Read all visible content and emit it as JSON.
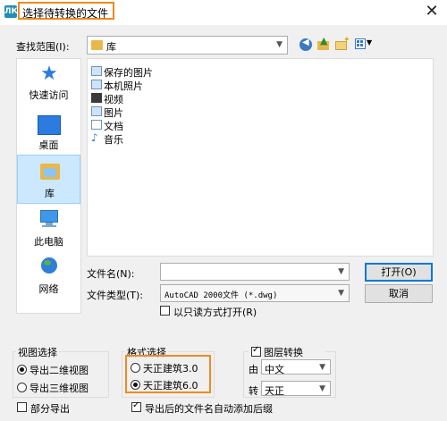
{
  "window": {
    "title": "选择待转换的文件",
    "app_icon_text": "ЛК"
  },
  "lookin": {
    "label": "查找范围(I):",
    "value": "库"
  },
  "places": [
    {
      "label": "快速访问"
    },
    {
      "label": "桌面"
    },
    {
      "label": "库"
    },
    {
      "label": "此电脑"
    },
    {
      "label": "网络"
    }
  ],
  "files": [
    {
      "name": "保存的图片"
    },
    {
      "name": "本机照片"
    },
    {
      "name": "视频"
    },
    {
      "name": "图片"
    },
    {
      "name": "文档"
    },
    {
      "name": "音乐"
    }
  ],
  "filename": {
    "label": "文件名(N):",
    "value": ""
  },
  "filetype": {
    "label": "文件类型(T):",
    "value": "AutoCAD 2000文件 (*.dwg)"
  },
  "readonly": {
    "label": "以只读方式打开(R)",
    "checked": false
  },
  "buttons": {
    "open": "打开(O)",
    "cancel": "取消"
  },
  "view_group": {
    "title": "视图选择",
    "options": [
      {
        "label": "导出二维视图",
        "selected": true
      },
      {
        "label": "导出三维视图",
        "selected": false
      }
    ]
  },
  "partial_export": {
    "label": "部分导出",
    "checked": false
  },
  "format_group": {
    "title": "格式选择",
    "options": [
      {
        "label": "天正建筑3.0",
        "selected": false
      },
      {
        "label": "天正建筑6.0",
        "selected": true
      }
    ]
  },
  "layer_group": {
    "title": "图层转换",
    "checked": true,
    "from_label": "由",
    "from_value": "中文",
    "to_label": "转",
    "to_value": "天正"
  },
  "suffix": {
    "label": "导出后的文件名自动添加后缀",
    "checked": true
  },
  "colors": {
    "highlight": "#f08a1c",
    "selection": "#cce8ff"
  }
}
